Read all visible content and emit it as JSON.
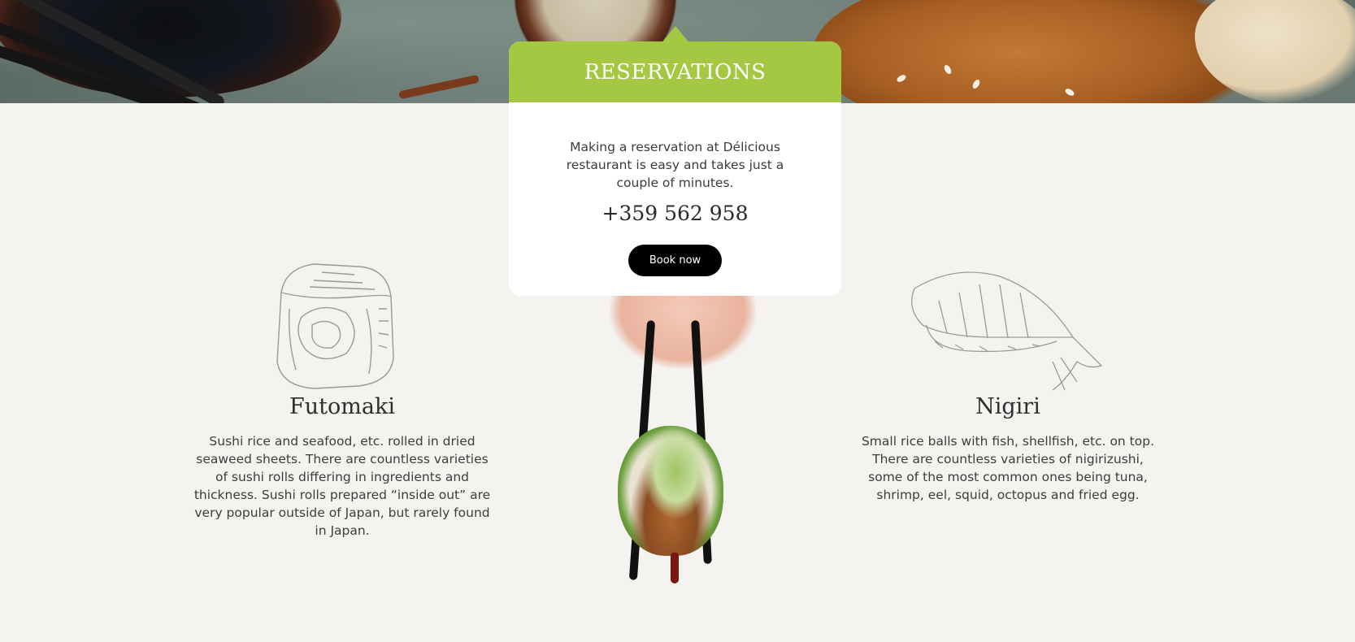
{
  "reservations": {
    "title": "RESERVATIONS",
    "description": "Making a reservation at Délicious restaurant is easy and takes just a couple of minutes.",
    "phone": "+359 562 958",
    "button_label": "Book now"
  },
  "features": [
    {
      "title": "Futomaki",
      "description": "Sushi rice and seafood, etc. rolled in dried seaweed sheets. There are countless varieties of sushi rolls differing in ingredients and thickness. Sushi rolls prepared “inside out” are very popular outside of Japan, but rarely found in Japan.",
      "icon": "futomaki-sketch-icon"
    },
    {
      "title": "Nigiri",
      "description": "Small rice balls with fish, shellfish, etc. on top. There are countless varieties of nigirizushi, some of the most common ones being tuna, shrimp, eel, squid, octopus and fried egg.",
      "icon": "nigiri-sketch-icon"
    }
  ],
  "colors": {
    "accent": "#a5c843",
    "background": "#f4f3f0",
    "button": "#000000"
  }
}
